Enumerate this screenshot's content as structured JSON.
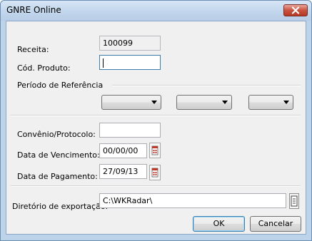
{
  "window": {
    "title": "GNRE Online"
  },
  "fields": {
    "receita": {
      "label": "Receita:",
      "value": "100099"
    },
    "cod_produto": {
      "label": "Cód. Produto:",
      "value": ""
    },
    "periodo": {
      "label": "Período de Referência"
    },
    "convenio": {
      "label": "Convênio/Protocolo:",
      "value": ""
    },
    "vencimento": {
      "label": "Data de Vencimento:",
      "value": "00/00/00"
    },
    "pagamento": {
      "label": "Data de Pagamento:",
      "value": "27/09/13"
    },
    "diretorio": {
      "label": "Diretório de exportação:",
      "value": "C:\\WKRadar\\"
    }
  },
  "buttons": {
    "ok": "OK",
    "cancel": "Cancelar"
  },
  "colors": {
    "calendar_accent": "#c0392b",
    "titlebar": "#c2d6ec",
    "close": "#c8533f"
  }
}
